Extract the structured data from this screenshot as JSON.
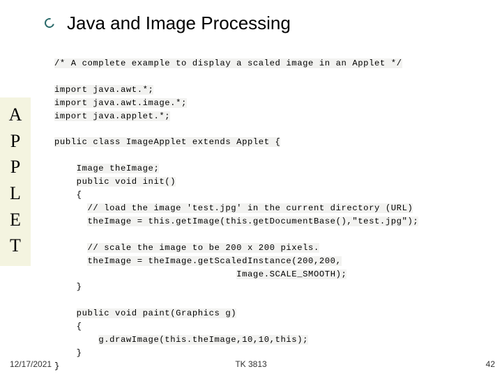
{
  "title": "Java and Image Processing",
  "sidebar": {
    "letters": [
      "A",
      "P",
      "P",
      "L",
      "E",
      "T"
    ]
  },
  "code": {
    "line1": "/* A complete example to display a scaled image in an Applet */",
    "line2": "import java.awt.*;",
    "line3": "import java.awt.image.*;",
    "line4": "import java.applet.*;",
    "line5": "public class ImageApplet extends Applet {",
    "line6": "Image theImage;",
    "line7": "public void init()",
    "line8": "{",
    "line9": "// load the image 'test.jpg' in the current directory (URL)",
    "line10": "theImage = this.getImage(this.getDocumentBase(),\"test.jpg\");",
    "line11": "// scale the image to be 200 x 200 pixels.",
    "line12": "theImage = theImage.getScaledInstance(200,200,",
    "line13": "Image.SCALE_SMOOTH);",
    "line14": "}",
    "line15": "public void paint(Graphics g)",
    "line16": "{",
    "line17": "g.drawImage(this.theImage,10,10,this);",
    "line18": "}",
    "line19": "}"
  },
  "footer": {
    "date": "12/17/2021",
    "course": "TK 3813",
    "page": "42"
  }
}
